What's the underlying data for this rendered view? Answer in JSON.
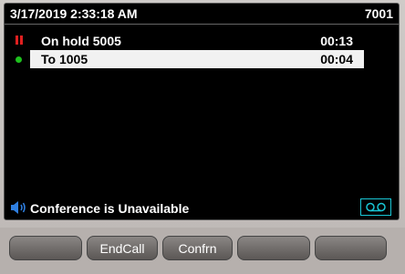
{
  "header": {
    "datetime": "3/17/2019 2:33:18 AM",
    "extension": "7001"
  },
  "calls": [
    {
      "label": "On hold 5005",
      "time": "00:13",
      "state": "hold",
      "state_color": "#e02020"
    },
    {
      "label": "To 1005",
      "time": "00:04",
      "state": "active",
      "state_color": "#1ec01e",
      "selected": true
    }
  ],
  "status": {
    "icon": "speaker-icon",
    "text": "Conference is Unavailable"
  },
  "voicemail": {
    "icon": "voicemail-icon",
    "color": "#19c7d6"
  },
  "softkeys": [
    "",
    "EndCall",
    "Confrn",
    "",
    ""
  ]
}
